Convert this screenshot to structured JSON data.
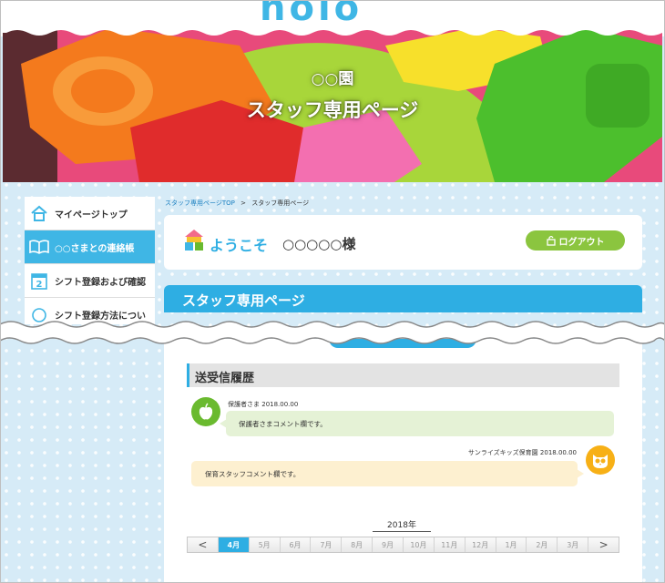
{
  "header": {
    "logo_fragment": "nolo",
    "hero_subtitle": "○○園",
    "hero_title": "スタッフ専用ページ"
  },
  "sidebar": {
    "items": [
      {
        "label": "マイページトップ",
        "icon": "house-icon",
        "active": false
      },
      {
        "label": "○○さまとの連絡帳",
        "icon": "open-book-icon",
        "active": true
      },
      {
        "label": "シフト登録および確認",
        "icon": "calendar-icon",
        "active": false
      },
      {
        "label": "シフト登録方法につい",
        "icon": "clock-icon",
        "active": false
      }
    ]
  },
  "breadcrumb": {
    "home": "スタッフ専用ページTOP",
    "separator": ">",
    "current": "スタッフ専用ページ"
  },
  "welcome": {
    "greeting": "ようこそ",
    "name": "○○○○○様",
    "logout_label": "ログアウト"
  },
  "page_header": {
    "title": "スタッフ専用ページ"
  },
  "history": {
    "title": "送受信履歴",
    "messages": [
      {
        "sender": "保護者さま",
        "date": "2018.00.00",
        "text": "保護者さまコメント欄です。",
        "avatar_icon": "apple-icon"
      },
      {
        "sender": "サンライズキッズ保育園",
        "date": "2018.00.00",
        "text": "保育スタッフコメント欄です。",
        "avatar_icon": "owl-icon"
      }
    ]
  },
  "calendar": {
    "year": "2018年",
    "prev": "<",
    "next": ">",
    "months": [
      "4月",
      "5月",
      "6月",
      "7月",
      "8月",
      "9月",
      "10月",
      "11月",
      "12月",
      "1月",
      "2月",
      "3月"
    ],
    "selected_month": "4月"
  },
  "colors": {
    "accent_blue": "#2eaee3",
    "logout_green": "#8bc53f",
    "parent_bubble": "#e5f2d6",
    "staff_bubble": "#fdf0d0"
  }
}
